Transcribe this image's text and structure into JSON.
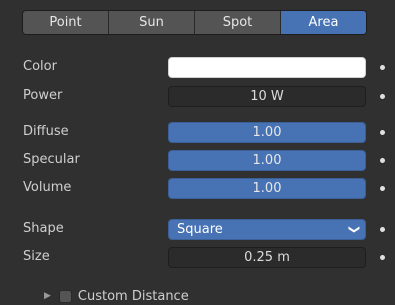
{
  "light_types": {
    "tabs": [
      "Point",
      "Sun",
      "Spot",
      "Area"
    ],
    "active": "Area"
  },
  "properties": {
    "color": {
      "label": "Color",
      "value": "#ffffff"
    },
    "power": {
      "label": "Power",
      "value": "10 W"
    },
    "diffuse": {
      "label": "Diffuse",
      "value": "1.00"
    },
    "specular": {
      "label": "Specular",
      "value": "1.00"
    },
    "volume": {
      "label": "Volume",
      "value": "1.00"
    },
    "shape": {
      "label": "Shape",
      "value": "Square"
    },
    "size": {
      "label": "Size",
      "value": "0.25 m"
    }
  },
  "custom_distance": {
    "label": "Custom Distance",
    "checked": false
  },
  "colors": {
    "accent": "#4772b3",
    "panel_bg": "#303030",
    "field_bg": "#2b2b2b"
  }
}
